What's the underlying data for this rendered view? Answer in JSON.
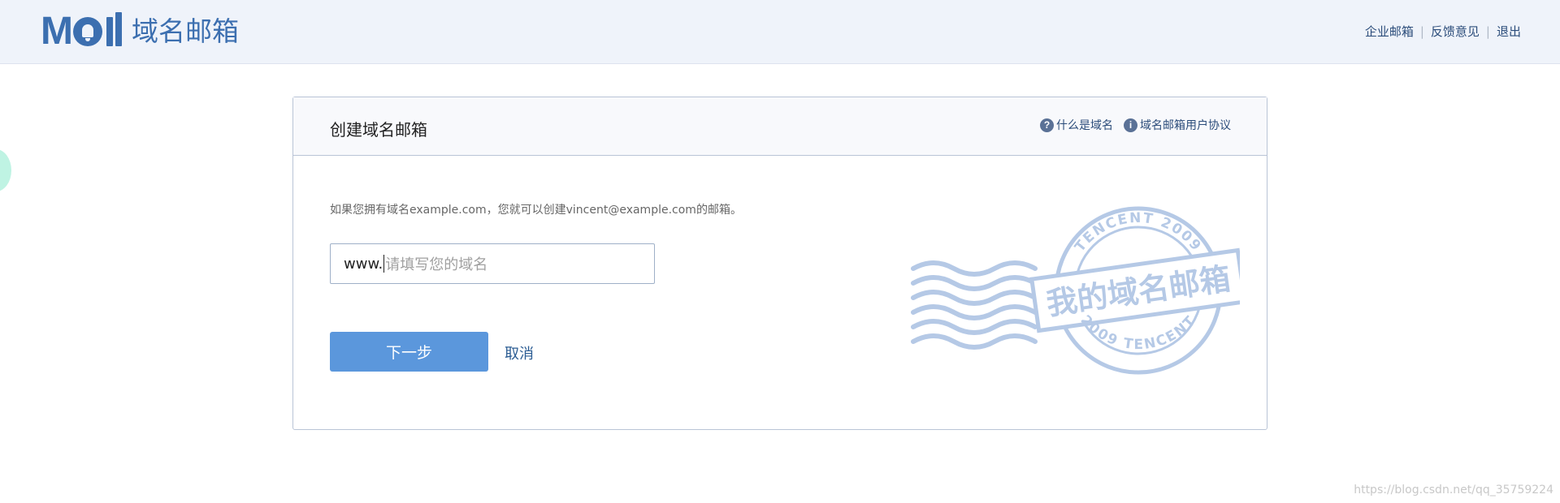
{
  "header": {
    "logo_text": "MOil",
    "title": "域名邮箱",
    "links": [
      "企业邮箱",
      "反馈意见",
      "退出"
    ]
  },
  "card": {
    "title": "创建域名邮箱",
    "help_links": [
      {
        "icon": "question-icon",
        "glyph": "?",
        "label": "什么是域名"
      },
      {
        "icon": "info-icon",
        "glyph": "i",
        "label": "域名邮箱用户协议"
      }
    ],
    "description": "如果您拥有域名example.com，您就可以创建vincent@example.com的邮箱。",
    "domain_input": {
      "prefix": "www.",
      "placeholder": "请填写您的域名",
      "value": ""
    },
    "next_label": "下一步",
    "cancel_label": "取消",
    "stamp": {
      "text": "我的域名邮箱",
      "ring_top": "TENCENT 2009",
      "ring_bottom": "2009 TENCENT"
    }
  },
  "watermark": "https://blog.csdn.net/qq_35759224",
  "colors": {
    "brand": "#3c6fb0",
    "header_bg": "#eff3fa",
    "button": "#5b97dc",
    "link": "#2b4c7a",
    "stamp": "#b5c9e6"
  }
}
